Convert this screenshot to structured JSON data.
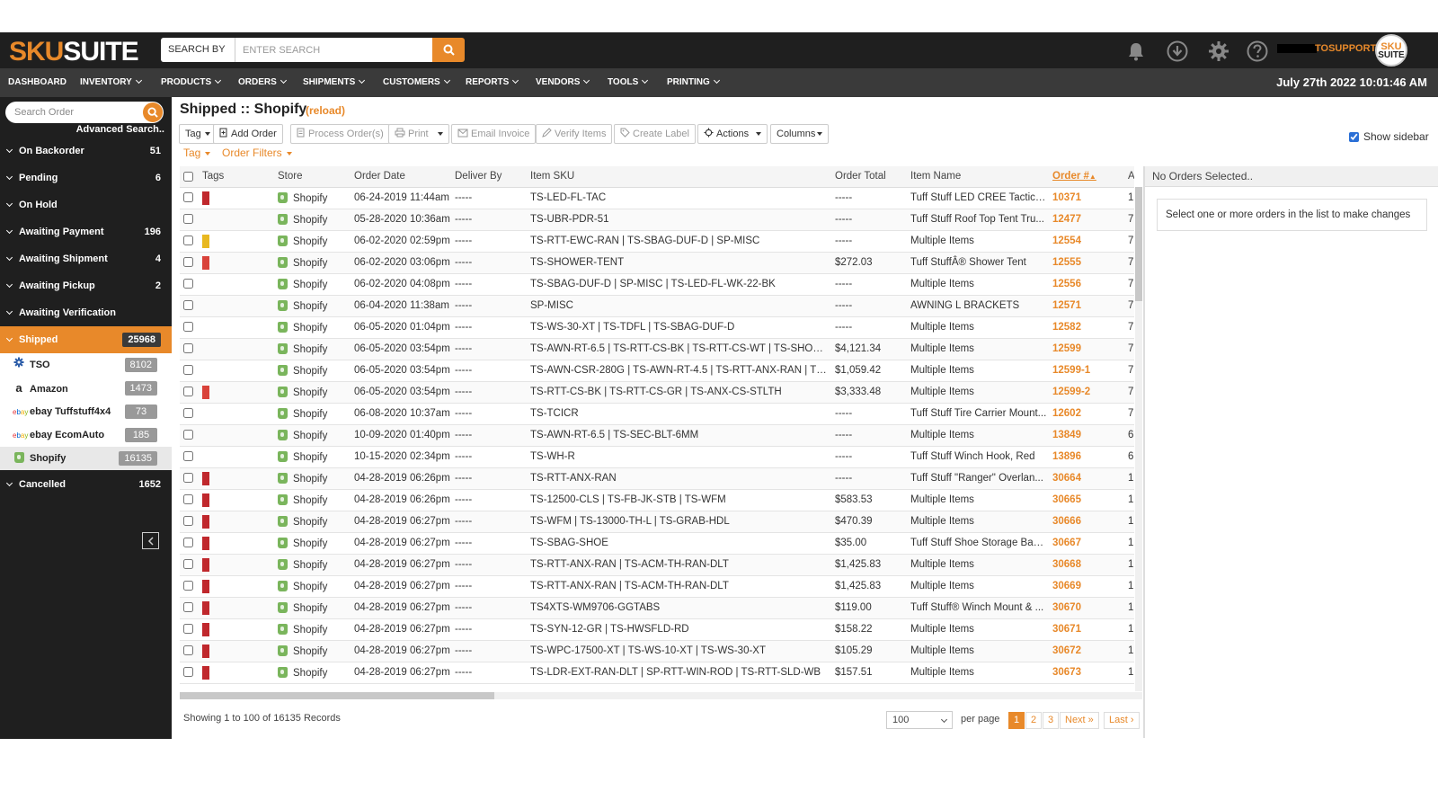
{
  "brand": {
    "sku": "SKU",
    "suite": "SUITE"
  },
  "header": {
    "search_by_label": "SEARCH BY",
    "search_placeholder": "ENTER SEARCH",
    "support_name": "TOSUPPORT",
    "avatar_top": "SKU",
    "avatar_bottom": "SUITE",
    "datetime": "July 27th 2022 10:01:46 AM"
  },
  "nav": [
    {
      "label": "DASHBOARD",
      "dropdown": false
    },
    {
      "label": "INVENTORY",
      "dropdown": true
    },
    {
      "label": "PRODUCTS",
      "dropdown": true
    },
    {
      "label": "ORDERS",
      "dropdown": true
    },
    {
      "label": "SHIPMENTS",
      "dropdown": true
    },
    {
      "label": "CUSTOMERS",
      "dropdown": true
    },
    {
      "label": "REPORTS",
      "dropdown": true
    },
    {
      "label": "VENDORS",
      "dropdown": true
    },
    {
      "label": "TOOLS",
      "dropdown": true
    },
    {
      "label": "PRINTING",
      "dropdown": true
    }
  ],
  "sidebar": {
    "search_placeholder": "Search Order",
    "advanced_search": "Advanced Search..",
    "statuses": [
      {
        "label": "On Backorder",
        "count": "51"
      },
      {
        "label": "Pending",
        "count": "6"
      },
      {
        "label": "On Hold",
        "count": ""
      },
      {
        "label": "Awaiting Payment",
        "count": "196"
      },
      {
        "label": "Awaiting Shipment",
        "count": "4"
      },
      {
        "label": "Awaiting Pickup",
        "count": "2"
      },
      {
        "label": "Awaiting Verification",
        "count": ""
      },
      {
        "label": "Shipped",
        "count": "25968"
      }
    ],
    "stores": [
      {
        "label": "TSO",
        "count": "8102",
        "icon": "gear-icon"
      },
      {
        "label": "Amazon",
        "count": "1473",
        "icon": "amazon-icon"
      },
      {
        "label": "ebay Tuffstuff4x4",
        "count": "73",
        "icon": "ebay-icon"
      },
      {
        "label": "ebay EcomAuto",
        "count": "185",
        "icon": "ebay-icon"
      },
      {
        "label": "Shopify",
        "count": "16135",
        "icon": "shopify-icon"
      }
    ],
    "cancelled": {
      "label": "Cancelled",
      "count": "1652"
    }
  },
  "main": {
    "title": "Shipped :: Shopify",
    "reload": "(reload)",
    "toolbar": {
      "tag": "Tag",
      "add_order": "Add Order",
      "process_orders": "Process Order(s)",
      "print": "Print",
      "email_invoice": "Email Invoice",
      "verify_items": "Verify Items",
      "create_label": "Create Label",
      "actions": "Actions",
      "columns": "Columns"
    },
    "filter_tag": "Tag",
    "filter_orders": "Order Filters",
    "show_sidebar": "Show sidebar"
  },
  "table": {
    "columns": [
      "Tags",
      "Store",
      "Order Date",
      "Deliver By",
      "Item SKU",
      "Order Total",
      "Item Name",
      "Order #",
      "Ag"
    ],
    "rows": [
      {
        "tag": "#c0282d",
        "store": "Shopify",
        "date": "06-24-2019 11:44am",
        "deliver": "-----",
        "sku": "TS-LED-FL-TAC",
        "total": "-----",
        "name": "Tuff Stuff LED CREE Tactical ...",
        "order": "10371",
        "age": "1"
      },
      {
        "tag": "",
        "store": "Shopify",
        "date": "05-28-2020 10:36am",
        "deliver": "-----",
        "sku": "TS-UBR-PDR-51",
        "total": "-----",
        "name": "Tuff Stuff Roof Top Tent Tru...",
        "order": "12477",
        "age": "7"
      },
      {
        "tag": "#e8b820",
        "store": "Shopify",
        "date": "06-02-2020 02:59pm",
        "deliver": "-----",
        "sku": "TS-RTT-EWC-RAN | TS-SBAG-DUF-D | SP-MISC",
        "total": "-----",
        "name": "Multiple Items",
        "order": "12554",
        "age": "7"
      },
      {
        "tag": "#d9423a",
        "store": "Shopify",
        "date": "06-02-2020 03:06pm",
        "deliver": "-----",
        "sku": "TS-SHOWER-TENT",
        "total": "$272.03",
        "name": "Tuff StuffÂ® Shower Tent",
        "order": "12555",
        "age": "7"
      },
      {
        "tag": "",
        "store": "Shopify",
        "date": "06-02-2020 04:08pm",
        "deliver": "-----",
        "sku": "TS-SBAG-DUF-D | SP-MISC | TS-LED-FL-WK-22-BK",
        "total": "-----",
        "name": "Multiple Items",
        "order": "12556",
        "age": "7"
      },
      {
        "tag": "",
        "store": "Shopify",
        "date": "06-04-2020 11:38am",
        "deliver": "-----",
        "sku": "SP-MISC",
        "total": "-----",
        "name": "AWNING L BRACKETS",
        "order": "12571",
        "age": "7"
      },
      {
        "tag": "",
        "store": "Shopify",
        "date": "06-05-2020 01:04pm",
        "deliver": "-----",
        "sku": "TS-WS-30-XT | TS-TDFL | TS-SBAG-DUF-D",
        "total": "-----",
        "name": "Multiple Items",
        "order": "12582",
        "age": "7"
      },
      {
        "tag": "",
        "store": "Shopify",
        "date": "06-05-2020 03:54pm",
        "deliver": "-----",
        "sku": "TS-AWN-RT-6.5 | TS-RTT-CS-BK | TS-RTT-CS-WT | TS-SHOWER-T...",
        "total": "$4,121.34",
        "name": "Multiple Items",
        "order": "12599",
        "age": "7"
      },
      {
        "tag": "",
        "store": "Shopify",
        "date": "06-05-2020 03:54pm",
        "deliver": "-----",
        "sku": "TS-AWN-CSR-280G | TS-AWN-RT-4.5 | TS-RTT-ANX-RAN | TS-TOI...",
        "total": "$1,059.42",
        "name": "Multiple Items",
        "order": "12599-1",
        "age": "7"
      },
      {
        "tag": "#d9423a",
        "store": "Shopify",
        "date": "06-05-2020 03:54pm",
        "deliver": "-----",
        "sku": "TS-RTT-CS-BK | TS-RTT-CS-GR | TS-ANX-CS-STLTH",
        "total": "$3,333.48",
        "name": "Multiple Items",
        "order": "12599-2",
        "age": "7"
      },
      {
        "tag": "",
        "store": "Shopify",
        "date": "06-08-2020 10:37am",
        "deliver": "-----",
        "sku": "TS-TCICR",
        "total": "-----",
        "name": "Tuff Stuff Tire Carrier Mount...",
        "order": "12602",
        "age": "7"
      },
      {
        "tag": "",
        "store": "Shopify",
        "date": "10-09-2020 01:40pm",
        "deliver": "-----",
        "sku": "TS-AWN-RT-6.5 | TS-SEC-BLT-6MM",
        "total": "-----",
        "name": "Multiple Items",
        "order": "13849",
        "age": "6"
      },
      {
        "tag": "",
        "store": "Shopify",
        "date": "10-15-2020 02:34pm",
        "deliver": "-----",
        "sku": "TS-WH-R",
        "total": "-----",
        "name": "Tuff Stuff Winch Hook, Red",
        "order": "13896",
        "age": "6"
      },
      {
        "tag": "#c0282d",
        "store": "Shopify",
        "date": "04-28-2019 06:26pm",
        "deliver": "-----",
        "sku": "TS-RTT-ANX-RAN",
        "total": "-----",
        "name": "Tuff Stuff \"Ranger\" Overlan...",
        "order": "30664",
        "age": "1"
      },
      {
        "tag": "#c0282d",
        "store": "Shopify",
        "date": "04-28-2019 06:26pm",
        "deliver": "-----",
        "sku": "TS-12500-CLS | TS-FB-JK-STB | TS-WFM",
        "total": "$583.53",
        "name": "Multiple Items",
        "order": "30665",
        "age": "1"
      },
      {
        "tag": "#c0282d",
        "store": "Shopify",
        "date": "04-28-2019 06:27pm",
        "deliver": "-----",
        "sku": "TS-WFM | TS-13000-TH-L | TS-GRAB-HDL",
        "total": "$470.39",
        "name": "Multiple Items",
        "order": "30666",
        "age": "1"
      },
      {
        "tag": "#c0282d",
        "store": "Shopify",
        "date": "04-28-2019 06:27pm",
        "deliver": "-----",
        "sku": "TS-SBAG-SHOE",
        "total": "$35.00",
        "name": "Tuff Stuff Shoe Storage Bag ...",
        "order": "30667",
        "age": "1"
      },
      {
        "tag": "#c0282d",
        "store": "Shopify",
        "date": "04-28-2019 06:27pm",
        "deliver": "-----",
        "sku": "TS-RTT-ANX-RAN | TS-ACM-TH-RAN-DLT",
        "total": "$1,425.83",
        "name": "Multiple Items",
        "order": "30668",
        "age": "1"
      },
      {
        "tag": "#c0282d",
        "store": "Shopify",
        "date": "04-28-2019 06:27pm",
        "deliver": "-----",
        "sku": "TS-RTT-ANX-RAN | TS-ACM-TH-RAN-DLT",
        "total": "$1,425.83",
        "name": "Multiple Items",
        "order": "30669",
        "age": "1"
      },
      {
        "tag": "#c0282d",
        "store": "Shopify",
        "date": "04-28-2019 06:27pm",
        "deliver": "-----",
        "sku": "TS4XTS-WM9706-GGTABS",
        "total": "$119.00",
        "name": "Tuff Stuff® Winch Mount & ...",
        "order": "30670",
        "age": "1"
      },
      {
        "tag": "#c0282d",
        "store": "Shopify",
        "date": "04-28-2019 06:27pm",
        "deliver": "-----",
        "sku": "TS-SYN-12-GR | TS-HWSFLD-RD",
        "total": "$158.22",
        "name": "Multiple Items",
        "order": "30671",
        "age": "1"
      },
      {
        "tag": "#c0282d",
        "store": "Shopify",
        "date": "04-28-2019 06:27pm",
        "deliver": "-----",
        "sku": "TS-WPC-17500-XT | TS-WS-10-XT | TS-WS-30-XT",
        "total": "$105.29",
        "name": "Multiple Items",
        "order": "30672",
        "age": "1"
      },
      {
        "tag": "#c0282d",
        "store": "Shopify",
        "date": "04-28-2019 06:27pm",
        "deliver": "-----",
        "sku": "TS-LDR-EXT-RAN-DLT | SP-RTT-WIN-ROD | TS-RTT-SLD-WB",
        "total": "$157.51",
        "name": "Multiple Items",
        "order": "30673",
        "age": "1"
      }
    ]
  },
  "footer": {
    "records_info": "Showing 1 to 100 of 16135 Records",
    "per_page_value": "100",
    "per_page_label": "per page",
    "pages": [
      "1",
      "2",
      "3",
      "Next »",
      "Last ›"
    ]
  },
  "right_panel": {
    "header": "No Orders Selected..",
    "message": "Select one or more orders in the list to make changes"
  },
  "colors": {
    "accent": "#e8892a",
    "dark": "#1f1f1f",
    "nav": "#3a3a3a"
  }
}
